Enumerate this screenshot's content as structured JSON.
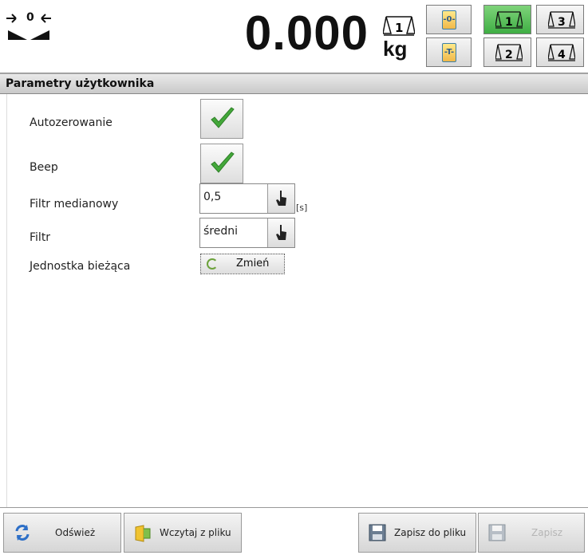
{
  "header": {
    "zero_indicator": "0",
    "weight": "0.000",
    "unit": "kg",
    "platform_indicator": "1",
    "zero_button_icon": "zero-icon",
    "tare_button_icon": "tare-icon",
    "platforms": [
      {
        "label": "1",
        "active": true
      },
      {
        "label": "3",
        "active": false
      },
      {
        "label": "2",
        "active": false
      },
      {
        "label": "4",
        "active": false
      }
    ],
    "active_color": "#4cbc4f"
  },
  "title": "Parametry użytkownika",
  "settings": {
    "autozero": {
      "label": "Autozerowanie",
      "checked": true
    },
    "beep": {
      "label": "Beep",
      "checked": true
    },
    "median_filter": {
      "label": "Filtr medianowy",
      "value": "0,5",
      "unit": "[s]"
    },
    "filter": {
      "label": "Filtr",
      "value": "średni"
    },
    "current_unit": {
      "label": "Jednostka bieżąca",
      "button": "Zmień"
    }
  },
  "toolbar": {
    "refresh": "Odśwież",
    "load_from_file": "Wczytaj z pliku",
    "save_to_file": "Zapisz do pliku",
    "save": "Zapisz"
  }
}
